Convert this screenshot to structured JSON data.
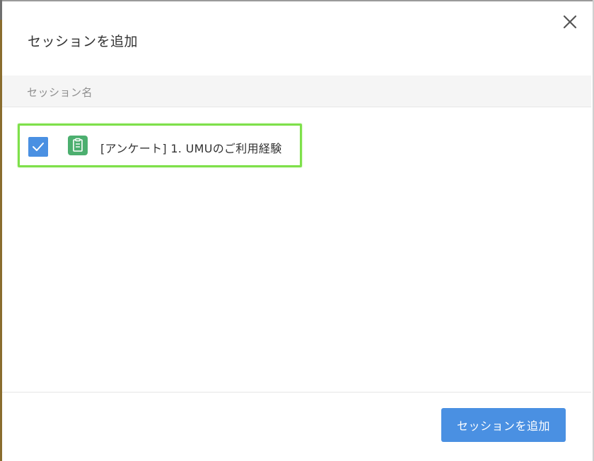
{
  "dialog": {
    "title": "セッションを追加",
    "close_icon": "close-icon"
  },
  "table": {
    "header_label": "セッション名"
  },
  "sessions": [
    {
      "label": "[アンケート] 1. UMUのご利用経験",
      "checked": true,
      "icon": "survey-icon"
    }
  ],
  "footer": {
    "add_button_label": "セッションを追加"
  },
  "colors": {
    "accent": "#4a90e2",
    "survey_icon": "#4caf6f",
    "highlight_border": "#7ee04a"
  }
}
